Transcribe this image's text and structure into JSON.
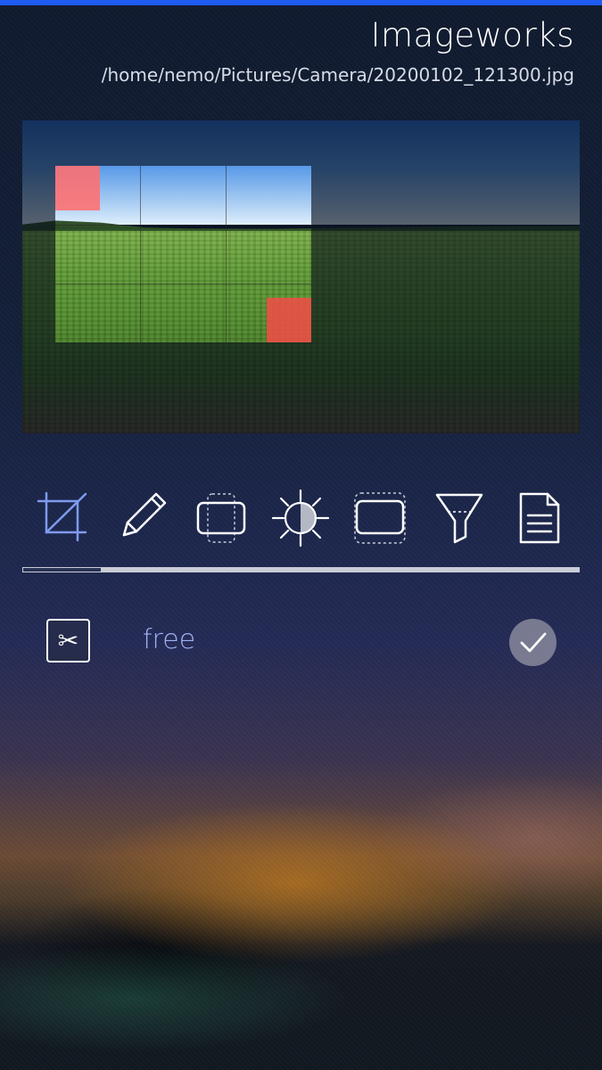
{
  "app": {
    "title": "Imageworks",
    "file_path": "/home/nemo/Pictures/Camera/20200102_121300.jpg"
  },
  "photo": {
    "description_icon": "photo-preview"
  },
  "toolbar": {
    "tools": [
      {
        "name": "crop-icon",
        "active": true
      },
      {
        "name": "pencil-icon",
        "active": false
      },
      {
        "name": "resize-icon",
        "active": false
      },
      {
        "name": "brightness-icon",
        "active": false
      },
      {
        "name": "dashed-rect-icon",
        "active": false
      },
      {
        "name": "filter-icon",
        "active": false
      },
      {
        "name": "document-icon",
        "active": false
      }
    ],
    "active_index": 0
  },
  "crop": {
    "tool_icon": "scissors-icon",
    "mode_label": "free",
    "apply_icon": "checkmark-icon"
  },
  "colors": {
    "accent": "#1e5bf0",
    "active_tool": "#7f9bf0",
    "mode_label": "#9fb2f5",
    "crop_handle_top_left": "#ff6e6e",
    "crop_handle_bottom_right": "#eb5046"
  }
}
